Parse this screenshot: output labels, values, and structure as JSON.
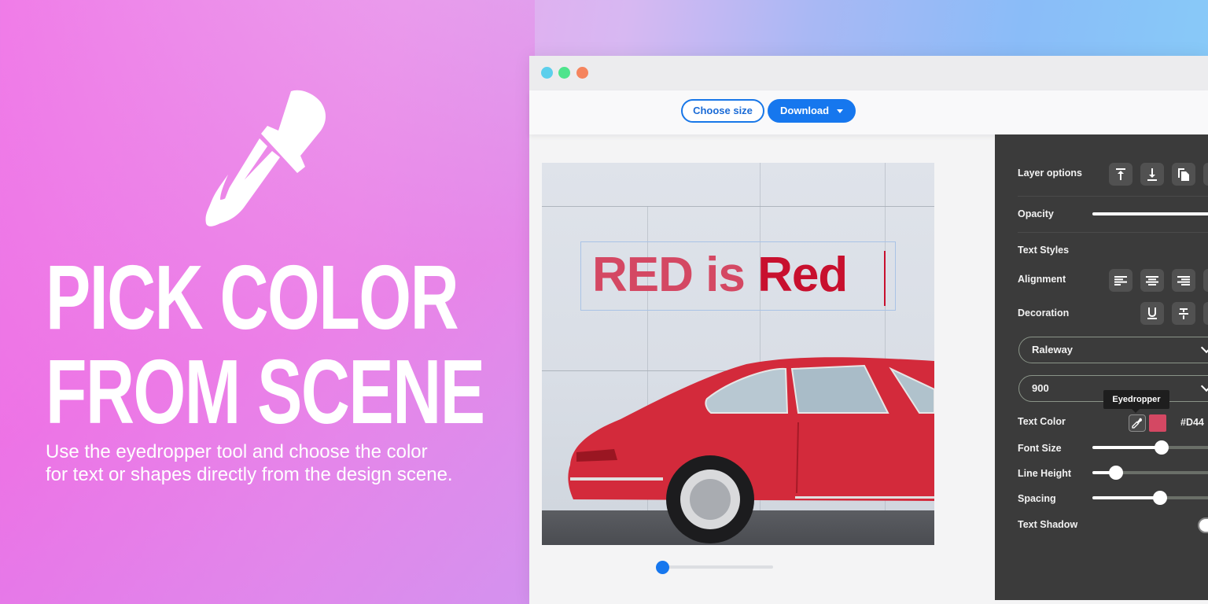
{
  "hero": {
    "icon": "eyedropper-icon",
    "title_line1": "PICK COLOR",
    "title_line2": "FROM SCENE",
    "subtitle_line1": "Use the eyedropper tool and choose the color",
    "subtitle_line2": "for text or shapes directly from the design scene."
  },
  "window": {
    "traffic_lights": [
      "#5ccfec",
      "#4ee48c",
      "#f5845e"
    ],
    "toolbar": {
      "choose_size_label": "Choose size",
      "download_label": "Download"
    },
    "canvas": {
      "text_part1": "RED is ",
      "text_part2": "Red",
      "text_color_1": "#d44863",
      "text_color_2": "#c8102e",
      "zoom_level": 0.05
    }
  },
  "panel": {
    "layer_options_label": "Layer options",
    "layer_icons": [
      "bring-to-front-icon",
      "send-to-back-icon",
      "duplicate-icon"
    ],
    "opacity_label": "Opacity",
    "opacity_value": 1.0,
    "text_styles_label": "Text Styles",
    "alignment_label": "Alignment",
    "alignment_icons": [
      "align-left-icon",
      "align-center-icon",
      "align-right-icon"
    ],
    "decoration_label": "Decoration",
    "decoration_icons": [
      "underline-icon",
      "strikethrough-icon"
    ],
    "font_family": "Raleway",
    "font_weight": "900",
    "tooltip": "Eyedropper",
    "text_color_label": "Text Color",
    "text_color_hex": "#D44",
    "text_color_swatch": "#d44863",
    "font_size_label": "Font Size",
    "font_size_value": 0.55,
    "line_height_label": "Line Height",
    "line_height_value": 0.19,
    "spacing_label": "Spacing",
    "spacing_value": 0.54,
    "text_shadow_label": "Text Shadow",
    "text_shadow_enabled": false
  }
}
